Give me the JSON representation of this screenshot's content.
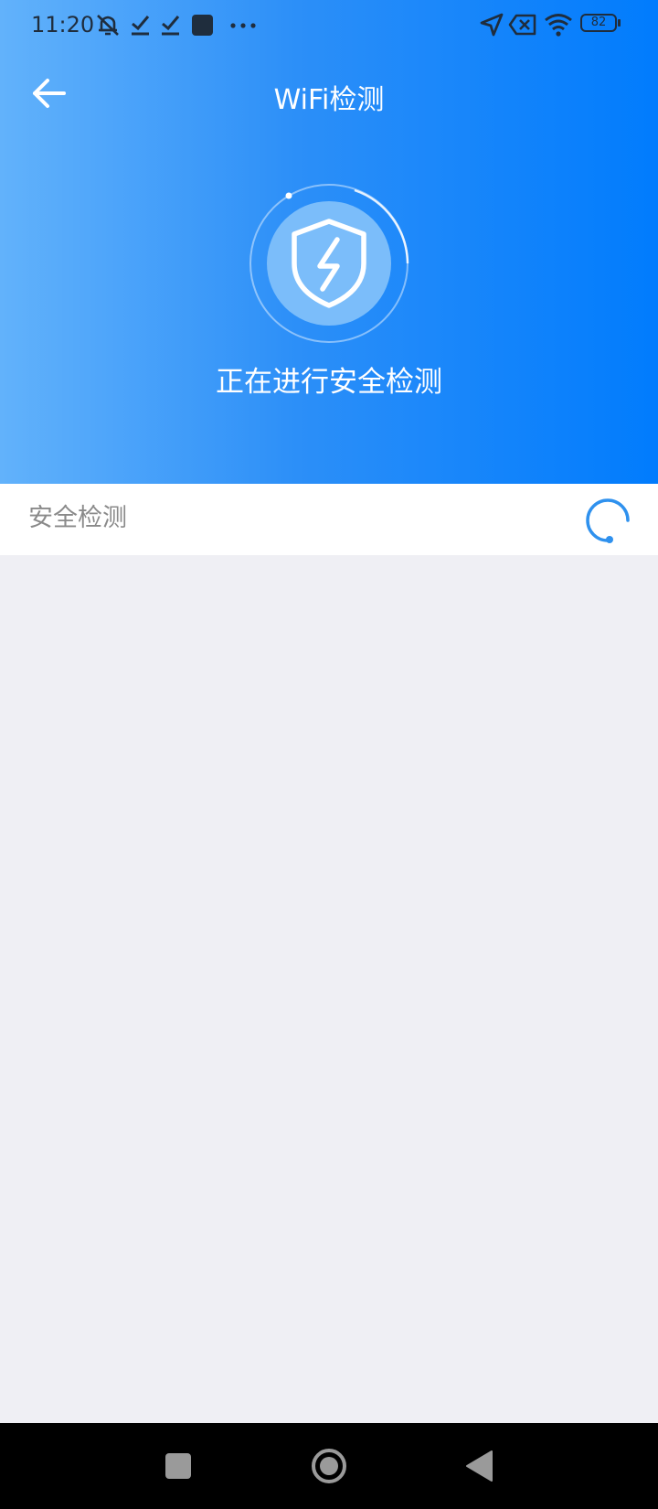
{
  "status_bar": {
    "time": "11:20",
    "battery_level": "82",
    "left_icons": [
      "notifications-muted-icon",
      "check-mark-icon",
      "check-mark-icon",
      "app-square-icon",
      "more-dots-icon"
    ],
    "right_icons": [
      "location-arrow-icon",
      "data-off-icon",
      "wifi-icon",
      "battery-icon"
    ]
  },
  "app_bar": {
    "title": "WiFi检测",
    "back_icon": "back-arrow-icon"
  },
  "scan": {
    "status_text": "正在进行安全检测",
    "emblem_icon": "shield-lightning-icon"
  },
  "checks": [
    {
      "label": "安全检测",
      "state_icon": "loading-spinner-icon"
    }
  ],
  "nav_bar": {
    "buttons": [
      "recent-apps-icon",
      "home-icon",
      "back-triangle-icon"
    ]
  },
  "colors": {
    "header_gradient_start": "#62b2fb",
    "header_gradient_end": "#017cfd",
    "page_background": "#efeff4",
    "row_label": "#8a8a8a",
    "spinner": "#2f91ee",
    "status_text": "#1f2d3d",
    "nav_bar": "#000000"
  }
}
